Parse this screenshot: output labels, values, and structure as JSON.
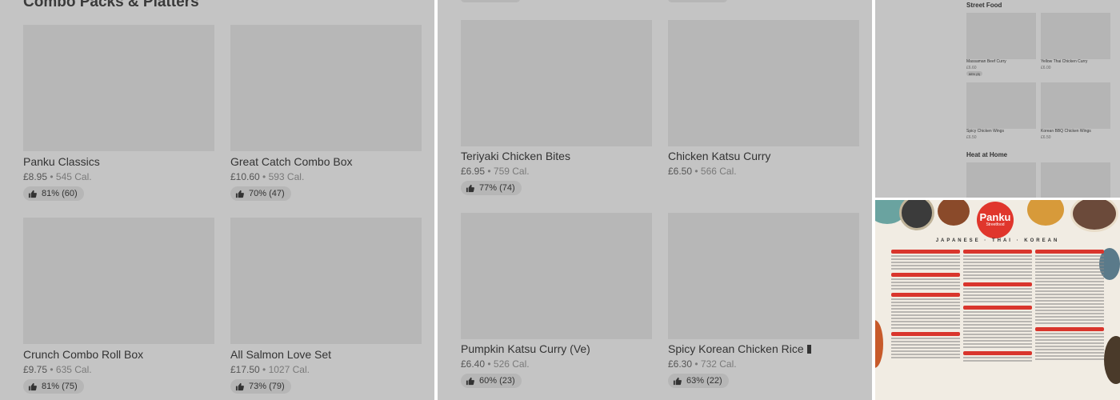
{
  "panel1": {
    "section_title": "Combo Packs & Platters",
    "items": [
      {
        "name": "Panku Classics",
        "price": "£8.95",
        "cal": "545 Cal.",
        "rating": "81% (60)"
      },
      {
        "name": "Great Catch Combo Box",
        "price": "£10.60",
        "cal": "593 Cal.",
        "rating": "70% (47)"
      },
      {
        "name": "Crunch Combo Roll Box",
        "price": "£9.75",
        "cal": "635 Cal.",
        "rating": "81% (75)"
      },
      {
        "name": "All Salmon Love Set",
        "price": "£17.50",
        "cal": "1027 Cal.",
        "rating": "73% (79)"
      }
    ]
  },
  "panel2": {
    "items": [
      {
        "name": "Teriyaki Chicken Bites",
        "price": "£6.95",
        "cal": "759 Cal.",
        "rating": "77% (74)"
      },
      {
        "name": "Chicken Katsu Curry",
        "price": "£6.50",
        "cal": "566 Cal.",
        "rating": ""
      },
      {
        "name": "Pumpkin Katsu Curry (Ve)",
        "price": "£6.40",
        "cal": "526 Cal.",
        "rating": "60% (23)"
      },
      {
        "name": "Spicy Korean Chicken Rice",
        "price": "£6.30",
        "cal": "732 Cal.",
        "rating": "63% (22)"
      }
    ]
  },
  "panel3": {
    "section_title": "Street Food",
    "section_title_2": "Heat at Home",
    "items": [
      {
        "name": "Massaman Beef Curry",
        "price": "£6.60",
        "rating": "88% (8)"
      },
      {
        "name": "Yellow Thai Chicken Curry",
        "price": "£6.00"
      },
      {
        "name": "Spicy Chicken Wings",
        "price": "£6.50"
      },
      {
        "name": "Korean BBQ Chicken Wings",
        "price": "£6.50"
      }
    ]
  },
  "poster": {
    "logo_text": "Panku",
    "logo_sub": "Streetfood",
    "cuisines": "JAPANESE · THAI · KOREAN",
    "accent": "#d9362d"
  },
  "colors": {
    "panel_bg": "#c4c4c4",
    "image_placeholder": "#b7b7b7",
    "badge_bg": "#b6b6b6"
  }
}
